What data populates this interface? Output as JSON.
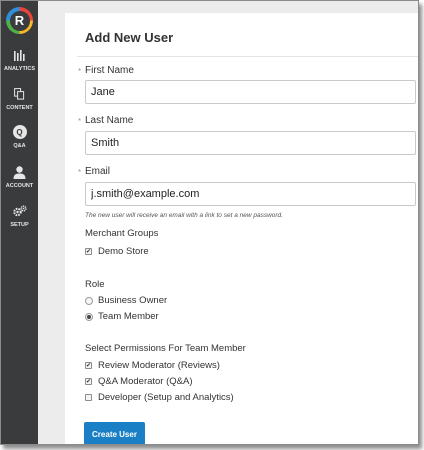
{
  "sidebar": {
    "logo_letter": "R",
    "items": [
      {
        "label": "ANALYTICS",
        "icon": "bar-chart-icon"
      },
      {
        "label": "CONTENT",
        "icon": "documents-icon"
      },
      {
        "label": "Q&A",
        "icon": "qa-bubble-icon"
      },
      {
        "label": "ACCOUNT",
        "icon": "person-icon"
      },
      {
        "label": "SETUP",
        "icon": "gears-icon"
      }
    ],
    "qa_icon_letter": "Q"
  },
  "form": {
    "title": "Add New User",
    "required_marker": "*",
    "first_name": {
      "label": "First Name",
      "value": "Jane"
    },
    "last_name": {
      "label": "Last Name",
      "value": "Smith"
    },
    "email": {
      "label": "Email",
      "value": "j.smith@example.com"
    },
    "email_hint": "The new user will receive an email with a link to set a new password.",
    "merchant_groups": {
      "label": "Merchant Groups",
      "options": [
        {
          "label": "Demo Store",
          "checked": true
        }
      ]
    },
    "role": {
      "label": "Role",
      "options": [
        {
          "label": "Business Owner",
          "selected": false
        },
        {
          "label": "Team Member",
          "selected": true
        }
      ]
    },
    "permissions": {
      "label": "Select Permissions For Team Member",
      "options": [
        {
          "label": "Review Moderator (Reviews)",
          "checked": true
        },
        {
          "label": "Q&A Moderator (Q&A)",
          "checked": true
        },
        {
          "label": "Developer (Setup and Analytics)",
          "checked": false
        }
      ]
    },
    "submit_label": "Create User"
  },
  "colors": {
    "sidebar_bg": "#3a3b3d",
    "accent_button": "#1a7fc4",
    "page_bg": "#ececec"
  }
}
